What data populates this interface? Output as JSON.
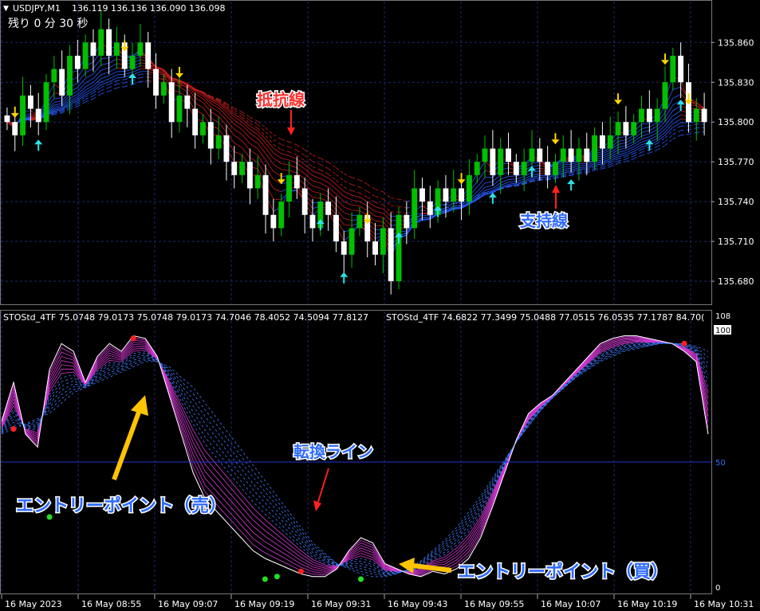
{
  "header": {
    "symbol_label": "USDJPY,M1",
    "ohlc": "136.119 136.136 136.090 136.098",
    "countdown": "残り 0 分 30 秒"
  },
  "indicator_header": {
    "line1": "STOStd_4TF 75.0748 79.0173 75.0748 79.0173 74.7046 78.4052 74.5094 77.8127",
    "line2": "STOStd_4TF 74.6822 77.3499 75.0488 77.0515 76.0535 77.1787 84.70("
  },
  "annotations": {
    "resistance": "抵抗線",
    "support": "支持線",
    "turn_line": "転換ライン",
    "entry_sell": "エントリーポイント（売）",
    "entry_buy": "エントリーポイント（買）"
  },
  "colors": {
    "background": "#000000",
    "grid": "#1c2a6e",
    "bull": "#00c000",
    "bear": "#ffffff",
    "resistance_band": "#c81e1e",
    "support_band": "#2a5cff",
    "stoch_fast": "#d63ad6",
    "stoch_slow": "#3f7bff",
    "arrow_up": "#2de2e6",
    "arrow_down": "#ffd400",
    "annotation_red": "#ff3030",
    "annotation_blue": "#2f6bff",
    "annotation_yellow": "#ffc400"
  },
  "chart_data": [
    {
      "type": "candlestick",
      "title": "USDJPY,M1",
      "ylim": [
        135.665,
        135.88
      ],
      "y_ticks": [
        "135.860",
        "135.830",
        "135.800",
        "135.770",
        "135.740",
        "135.710",
        "135.680"
      ],
      "x_ticks": [
        "16 May 2023",
        "16 May 08:55",
        "16 May 09:07",
        "16 May 09:19",
        "16 May 09:31",
        "16 May 09:43",
        "16 May 09:55",
        "16 May 10:07",
        "16 May 10:19",
        "16 May 10:31"
      ],
      "close": [
        135.8,
        135.79,
        135.82,
        135.81,
        135.8,
        135.83,
        135.84,
        135.82,
        135.85,
        135.84,
        135.86,
        135.85,
        135.87,
        135.85,
        135.86,
        135.84,
        135.85,
        135.86,
        135.84,
        135.82,
        135.83,
        135.8,
        135.82,
        135.81,
        135.79,
        135.8,
        135.78,
        135.79,
        135.77,
        135.76,
        135.77,
        135.75,
        135.76,
        135.73,
        135.72,
        135.74,
        135.76,
        135.75,
        135.73,
        135.72,
        135.74,
        135.73,
        135.71,
        135.7,
        135.72,
        135.73,
        135.71,
        135.7,
        135.72,
        135.68,
        135.73,
        135.72,
        135.75,
        135.74,
        135.73,
        135.75,
        135.74,
        135.75,
        135.74,
        135.76,
        135.77,
        135.78,
        135.76,
        135.78,
        135.77,
        135.76,
        135.77,
        135.78,
        135.77,
        135.76,
        135.77,
        135.78,
        135.77,
        135.78,
        135.77,
        135.79,
        135.78,
        135.79,
        135.8,
        135.79,
        135.8,
        135.81,
        135.8,
        135.81,
        135.83,
        135.85,
        135.83,
        135.8,
        135.81,
        135.8
      ],
      "arrows_up_idx": [
        4,
        16,
        40,
        43,
        50,
        55,
        62,
        67,
        72,
        82,
        86
      ],
      "arrows_down_idx": [
        1,
        15,
        22,
        35,
        46,
        58,
        70,
        78,
        84,
        87
      ]
    },
    {
      "type": "line",
      "title": "STOStd_4TF",
      "ylim": [
        0,
        108
      ],
      "y_ticks": [
        "108",
        "100",
        "50",
        "0"
      ],
      "fast": [
        65,
        80,
        60,
        55,
        85,
        95,
        92,
        80,
        90,
        95,
        92,
        98,
        97,
        90,
        75,
        60,
        45,
        35,
        30,
        25,
        20,
        15,
        12,
        10,
        8,
        6,
        5,
        5,
        8,
        15,
        20,
        18,
        10,
        8,
        6,
        5,
        7,
        6,
        8,
        12,
        20,
        32,
        45,
        58,
        68,
        72,
        75,
        80,
        85,
        90,
        95,
        97,
        98,
        98,
        97,
        96,
        95,
        92,
        88,
        60
      ],
      "slow": [
        60,
        62,
        64,
        66,
        68,
        72,
        76,
        78,
        80,
        82,
        84,
        86,
        88,
        88,
        86,
        82,
        78,
        72,
        66,
        60,
        54,
        48,
        42,
        36,
        30,
        24,
        18,
        14,
        10,
        8,
        6,
        5,
        5,
        6,
        8,
        11,
        15,
        19,
        24,
        30,
        36,
        43,
        50,
        57,
        63,
        69,
        74,
        78,
        82,
        85,
        88,
        90,
        92,
        93,
        94,
        95,
        95,
        95,
        94,
        92
      ]
    }
  ]
}
